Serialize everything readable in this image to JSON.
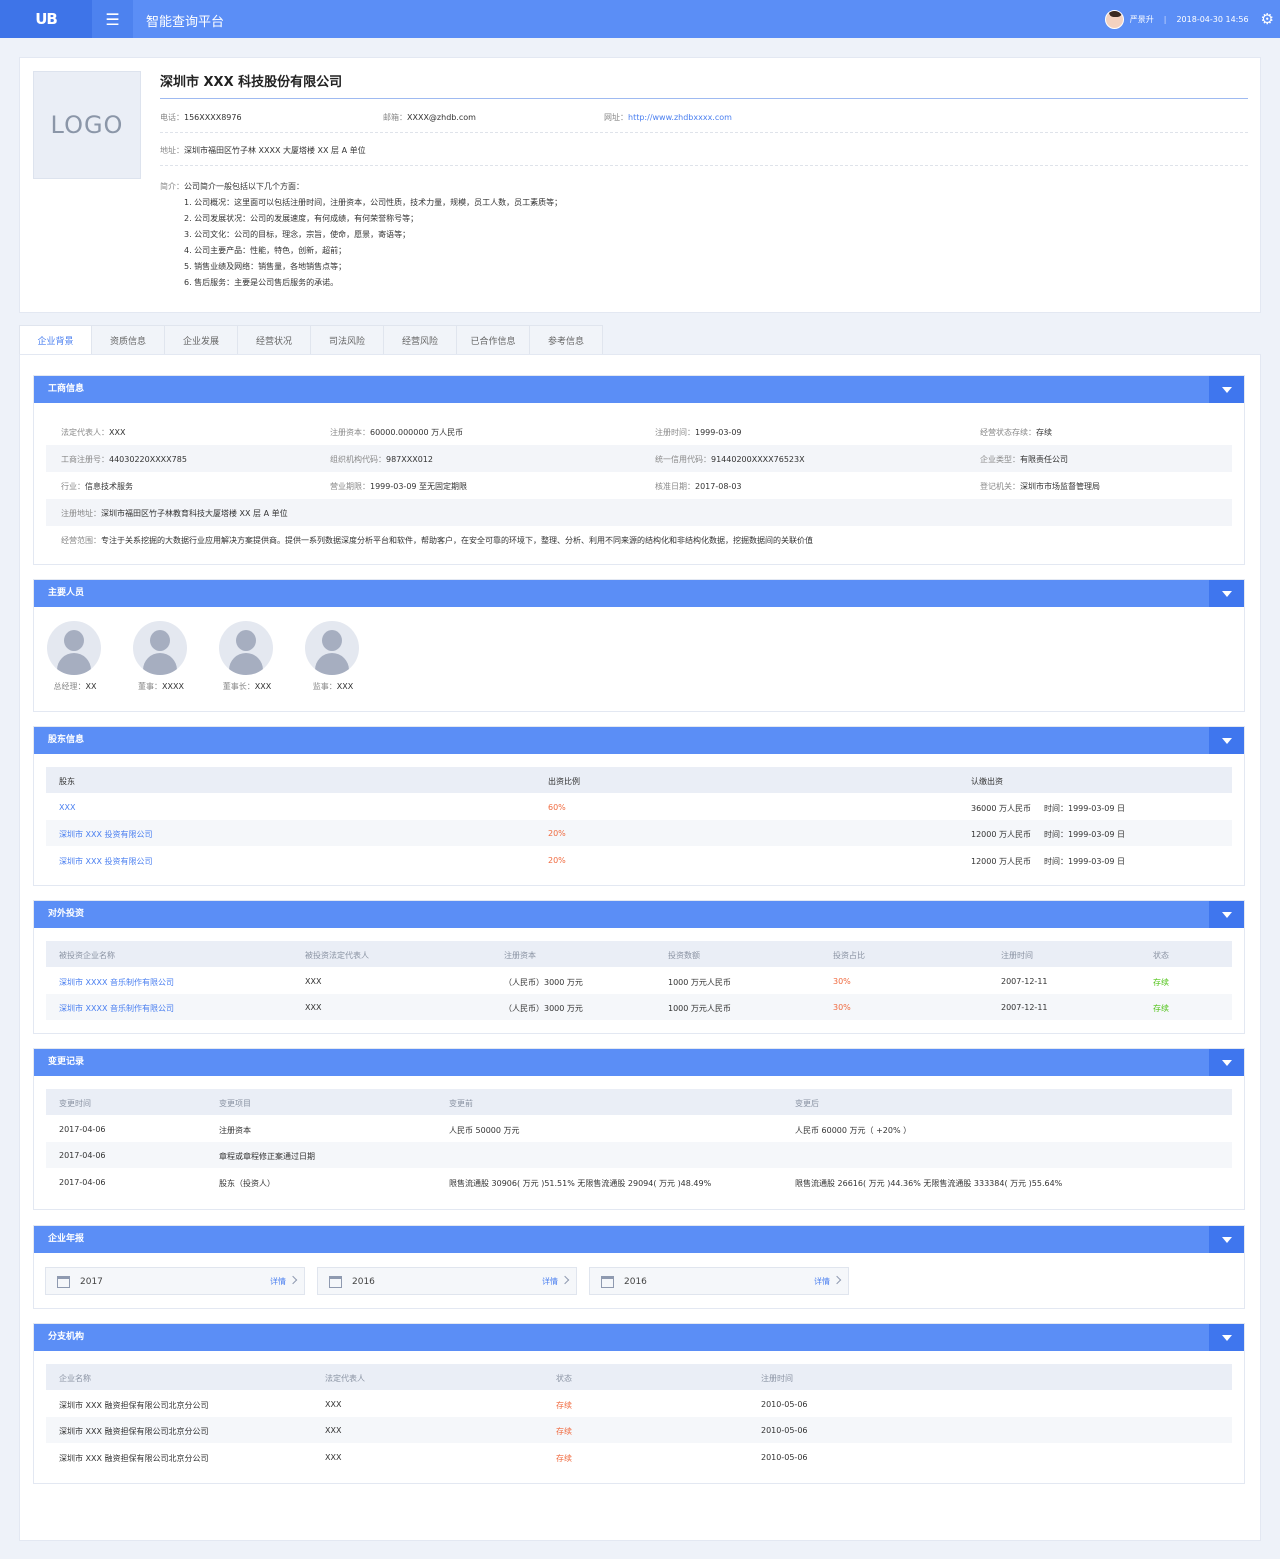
{
  "header": {
    "logo": "UB",
    "title": "智能查询平台",
    "user": "严景升",
    "sep": "|",
    "datetime": "2018-04-30 14:56"
  },
  "company": {
    "logo_text": "LOGO",
    "name": "深圳市 XXX 科技股份有限公司",
    "phone_label": "电话：",
    "phone": "156XXXX8976",
    "email_label": "邮箱：",
    "email": "XXXX@zhdb.com",
    "site_label": "网址：",
    "site": "http://www.zhdbxxxx.com",
    "addr_label": "地址：",
    "addr": "深圳市福田区竹子林 XXXX 大厦塔楼 XX 层 A 单位",
    "intro_label": "简介：",
    "intro_lead": "公司简介一般包括以下几个方面：",
    "intro_items": [
      "1. 公司概况：这里面可以包括注册时间，注册资本，公司性质，技术力量，规模，员工人数，员工素质等；",
      "2. 公司发展状况：公司的发展速度，有何成绩，有何荣誉称号等；",
      "3. 公司文化：公司的目标，理念，宗旨，使命，愿景，寄语等；",
      "4. 公司主要产品：性能，特色，创新，超前；",
      "5. 销售业绩及网络：销售量，各地销售点等；",
      "6. 售后服务：主要是公司售后服务的承诺。"
    ]
  },
  "tabs": [
    "企业背景",
    "资质信息",
    "企业发展",
    "经营状况",
    "司法风险",
    "经营风险",
    "已合作信息",
    "参考信息"
  ],
  "business": {
    "title": "工商信息",
    "rows": [
      [
        [
          "法定代表人：",
          "XXX"
        ],
        [
          "注册资本：",
          "60000.000000 万人民币"
        ],
        [
          "注册时间：",
          "1999-03-09"
        ],
        [
          "经营状态存续：",
          "存续"
        ]
      ],
      [
        [
          "工商注册号：",
          "44030220XXXX785"
        ],
        [
          "组织机构代码：",
          "987XXX012"
        ],
        [
          "统一信用代码：",
          "91440200XXXX76523X"
        ],
        [
          "企业类型：",
          "有限责任公司"
        ]
      ],
      [
        [
          "行业：",
          "信息技术服务"
        ],
        [
          "营业期限：",
          "1999-03-09 至无固定期限"
        ],
        [
          "核准日期：",
          "2017-08-03"
        ],
        [
          "登记机关：",
          "深圳市市场监督管理局"
        ]
      ]
    ],
    "reg_addr": [
      "注册地址：",
      "深圳市福田区竹子林教育科技大厦塔楼 XX 层 A 单位"
    ],
    "scope": [
      "经营范围：",
      "专注于关系挖掘的大数据行业应用解决方案提供商。提供一系列数据深度分析平台和软件，帮助客户，在安全可靠的环境下，整理、分析、利用不同来源的结构化和非结构化数据，挖掘数据间的关联价值"
    ]
  },
  "staff": {
    "title": "主要人员",
    "people": [
      [
        "总经理：",
        "XX"
      ],
      [
        "董事：",
        "XXXX"
      ],
      [
        "董事长：",
        "XXX"
      ],
      [
        "监事：",
        "XXX"
      ]
    ]
  },
  "shareholders": {
    "title": "股东信息",
    "headers": [
      "股东",
      "出资比例",
      "认缴出资"
    ],
    "rows": [
      [
        "XXX",
        "60%",
        "36000 万人民币",
        "时间：1999-03-09 日"
      ],
      [
        "深圳市 XXX 投资有限公司",
        "20%",
        "12000 万人民币",
        "时间：1999-03-09 日"
      ],
      [
        "深圳市 XXX 投资有限公司",
        "20%",
        "12000 万人民币",
        "时间：1999-03-09 日"
      ]
    ]
  },
  "investment": {
    "title": "对外投资",
    "headers": [
      "被投资企业名称",
      "被投资法定代表人",
      "注册资本",
      "投资数额",
      "投资占比",
      "注册时间",
      "状态"
    ],
    "rows": [
      [
        "深圳市 XXXX 音乐制作有限公司",
        "XXX",
        "（人民币）3000 万元",
        "1000 万元人民币",
        "30%",
        "2007-12-11",
        "存续"
      ],
      [
        "深圳市 XXXX 音乐制作有限公司",
        "XXX",
        "（人民币）3000 万元",
        "1000 万元人民币",
        "30%",
        "2007-12-11",
        "存续"
      ]
    ]
  },
  "changes": {
    "title": "变更记录",
    "headers": [
      "变更时间",
      "变更项目",
      "变更前",
      "变更后"
    ],
    "rows": [
      [
        "2017-04-06",
        "注册资本",
        "人民币 50000 万元",
        "人民币 60000 万元（ +20% ）"
      ],
      [
        "2017-04-06",
        "章程或章程修正案通过日期",
        "",
        ""
      ],
      [
        "2017-04-06",
        "股东（投资人）",
        "限售流通股 30906( 万元 )51.51% 无限售流通股 29094( 万元 )48.49%",
        "限售流通股 26616( 万元 )44.36% 无限售流通股 333384( 万元 )55.64%"
      ]
    ]
  },
  "annual": {
    "title": "企业年报",
    "detail_label": "详情",
    "years": [
      "2017",
      "2016",
      "2016"
    ]
  },
  "branches": {
    "title": "分支机构",
    "headers": [
      "企业名称",
      "法定代表人",
      "状态",
      "注册时间"
    ],
    "rows": [
      [
        "深圳市 XXX 融资担保有限公司北京分公司",
        "XXX",
        "存续",
        "2010-05-06"
      ],
      [
        "深圳市 XXX 融资担保有限公司北京分公司",
        "XXX",
        "存续",
        "2010-05-06"
      ],
      [
        "深圳市 XXX 融资担保有限公司北京分公司",
        "XXX",
        "存续",
        "2010-05-06"
      ]
    ]
  },
  "colors": {
    "accent": "#5b8ef6",
    "accent_dark": "#3f76ee",
    "link": "#4a7ff0",
    "pct": "#f06a3f",
    "ok": "#52c41a"
  },
  "icons": {
    "menu": "menu-icon",
    "settings": "gear-icon",
    "toggle": "chevron-down-icon",
    "calendar": "calendar-icon",
    "arrow": "chevron-right-icon"
  }
}
